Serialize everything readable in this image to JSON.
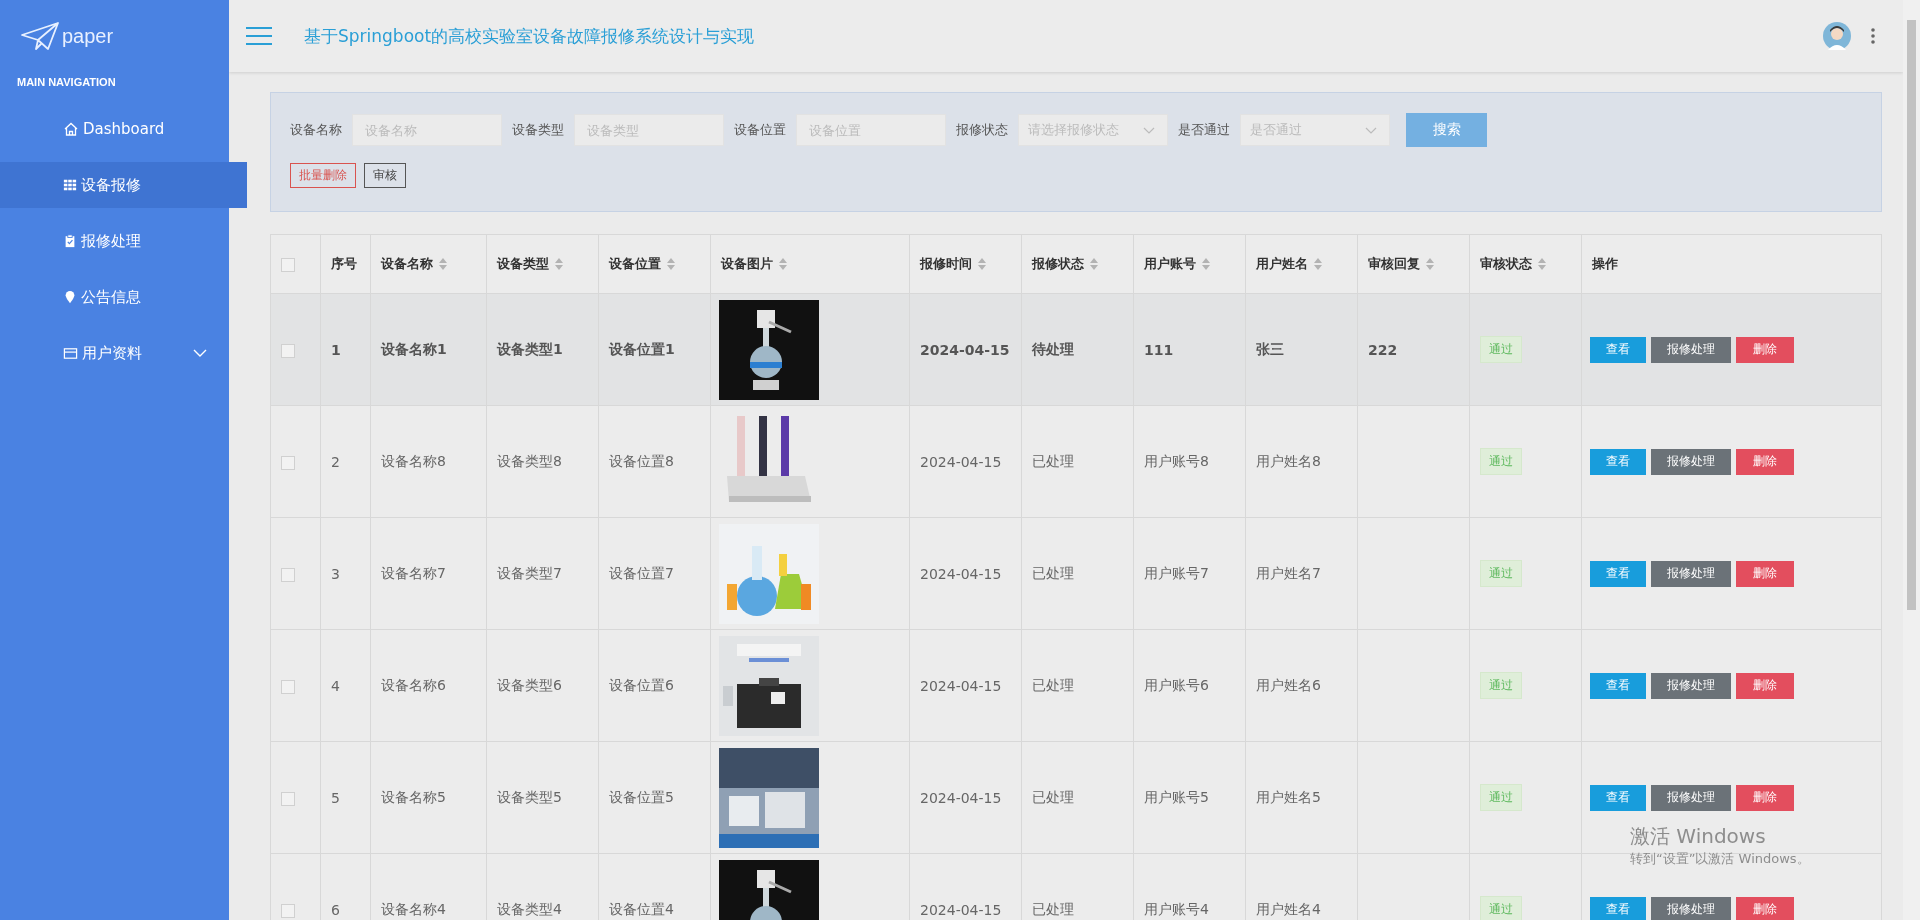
{
  "sidebar": {
    "logo": "paper",
    "section": "MAIN NAVIGATION",
    "items": [
      {
        "label": "Dashboard",
        "selected": false
      },
      {
        "label": "设备报修",
        "selected": true
      },
      {
        "label": "报修处理",
        "selected": false
      },
      {
        "label": "公告信息",
        "selected": false
      },
      {
        "label": "用户资料",
        "selected": false,
        "expanded": false
      }
    ]
  },
  "header": {
    "title": "基于Springboot的高校实验室设备故障报修系统设计与实现"
  },
  "filters": {
    "fields": [
      {
        "label": "设备名称",
        "placeholder": "设备名称",
        "kind": "input"
      },
      {
        "label": "设备类型",
        "placeholder": "设备类型",
        "kind": "input"
      },
      {
        "label": "设备位置",
        "placeholder": "设备位置",
        "kind": "input"
      },
      {
        "label": "报修状态",
        "placeholder": "请选择报修状态",
        "kind": "select"
      },
      {
        "label": "是否通过",
        "placeholder": "是否通过",
        "kind": "select"
      }
    ],
    "search_button": "搜索",
    "actions": [
      {
        "label": "批量删除",
        "kind": "danger"
      },
      {
        "label": "审核",
        "kind": "plain"
      }
    ]
  },
  "table": {
    "all_checked": false,
    "columns": [
      {
        "label": "序号",
        "sortable": false
      },
      {
        "label": "设备名称",
        "sortable": true
      },
      {
        "label": "设备类型",
        "sortable": true
      },
      {
        "label": "设备位置",
        "sortable": true
      },
      {
        "label": "设备图片",
        "sortable": true
      },
      {
        "label": "报修时间",
        "sortable": true
      },
      {
        "label": "报修状态",
        "sortable": true
      },
      {
        "label": "用户账号",
        "sortable": true
      },
      {
        "label": "用户姓名",
        "sortable": true
      },
      {
        "label": "审核回复",
        "sortable": true
      },
      {
        "label": "审核状态",
        "sortable": true
      },
      {
        "label": "操作",
        "sortable": false
      }
    ],
    "rows": [
      {
        "selected": true,
        "checked": false,
        "no": "1",
        "name": "设备名称1",
        "type": "设备类型1",
        "location": "设备位置1",
        "time": "2024-04-15",
        "status": "待处理",
        "account": "111",
        "user": "张三",
        "reply": "222",
        "audit": "通过",
        "actions": [
          {
            "label": "查看",
            "kind": "view"
          },
          {
            "label": "报修处理",
            "kind": "process"
          },
          {
            "label": "删除",
            "kind": "delete"
          }
        ]
      },
      {
        "selected": false,
        "checked": false,
        "no": "2",
        "name": "设备名称8",
        "type": "设备类型8",
        "location": "设备位置8",
        "time": "2024-04-15",
        "status": "已处理",
        "account": "用户账号8",
        "user": "用户姓名8",
        "audit": "通过",
        "actions": [
          {
            "label": "查看",
            "kind": "view"
          },
          {
            "label": "报修处理",
            "kind": "process"
          },
          {
            "label": "删除",
            "kind": "delete"
          }
        ]
      },
      {
        "selected": false,
        "checked": false,
        "no": "3",
        "name": "设备名称7",
        "type": "设备类型7",
        "location": "设备位置7",
        "time": "2024-04-15",
        "status": "已处理",
        "account": "用户账号7",
        "user": "用户姓名7",
        "audit": "通过",
        "actions": [
          {
            "label": "查看",
            "kind": "view"
          },
          {
            "label": "报修处理",
            "kind": "process"
          },
          {
            "label": "删除",
            "kind": "delete"
          }
        ]
      },
      {
        "selected": false,
        "checked": false,
        "no": "4",
        "name": "设备名称6",
        "type": "设备类型6",
        "location": "设备位置6",
        "time": "2024-04-15",
        "status": "已处理",
        "account": "用户账号6",
        "user": "用户姓名6",
        "audit": "通过",
        "actions": [
          {
            "label": "查看",
            "kind": "view"
          },
          {
            "label": "报修处理",
            "kind": "process"
          },
          {
            "label": "删除",
            "kind": "delete"
          }
        ]
      },
      {
        "selected": false,
        "checked": false,
        "no": "5",
        "name": "设备名称5",
        "type": "设备类型5",
        "location": "设备位置5",
        "time": "2024-04-15",
        "status": "已处理",
        "account": "用户账号5",
        "user": "用户姓名5",
        "audit": "通过",
        "actions": [
          {
            "label": "查看",
            "kind": "view"
          },
          {
            "label": "报修处理",
            "kind": "process"
          },
          {
            "label": "删除",
            "kind": "delete"
          }
        ]
      },
      {
        "selected": false,
        "checked": false,
        "no": "6",
        "name": "设备名称4",
        "type": "设备类型4",
        "location": "设备位置4",
        "time": "2024-04-15",
        "status": "已处理",
        "account": "用户账号4",
        "user": "用户姓名4",
        "audit": "通过",
        "actions": [
          {
            "label": "查看",
            "kind": "view"
          },
          {
            "label": "报修处理",
            "kind": "process"
          },
          {
            "label": "删除",
            "kind": "delete"
          }
        ]
      }
    ]
  },
  "os_notice": {
    "title": "激活 Windows",
    "text": "转到“设置”以激活 Windows。"
  }
}
